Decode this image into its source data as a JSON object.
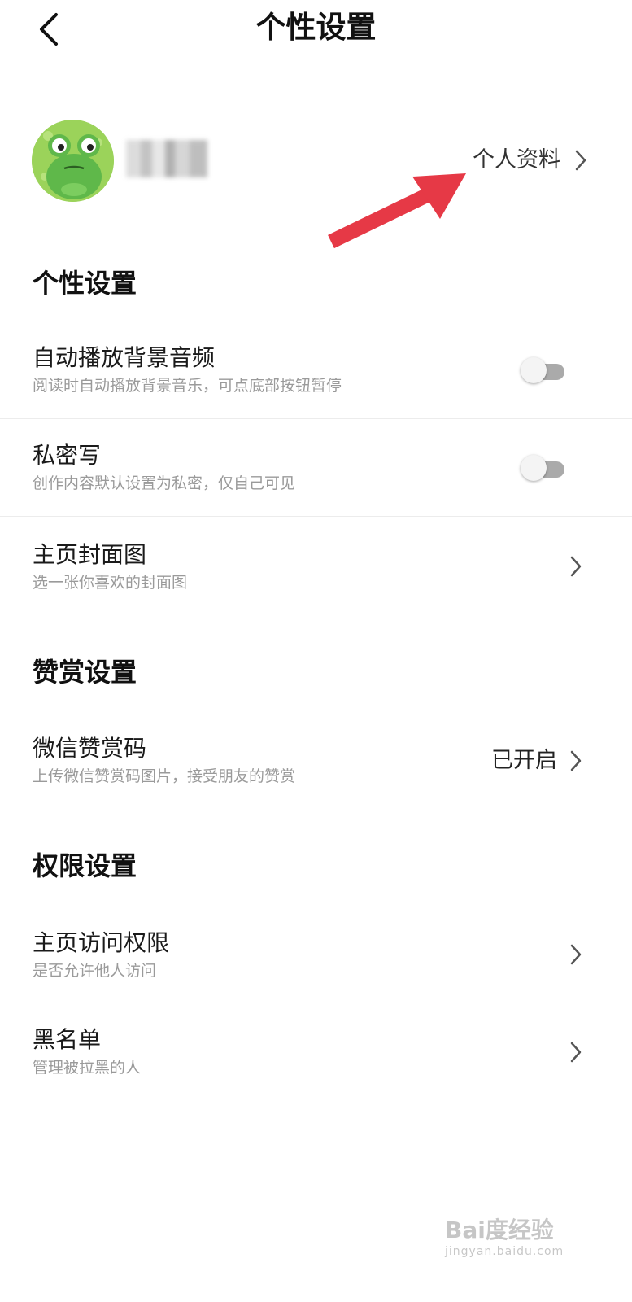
{
  "header": {
    "title": "个性设置",
    "back_icon": "chevron-left-icon"
  },
  "profile": {
    "avatar_icon": "frog-avatar",
    "username_blurred": true,
    "link_label": "个人资料"
  },
  "sections": {
    "personal": {
      "title": "个性设置",
      "items": [
        {
          "title": "自动播放背景音频",
          "subtitle": "阅读时自动播放背景音乐，可点底部按钮暂停",
          "control": "toggle",
          "enabled": false
        },
        {
          "title": "私密写",
          "subtitle": "创作内容默认设置为私密，仅自己可见",
          "control": "toggle",
          "enabled": false
        },
        {
          "title": "主页封面图",
          "subtitle": "选一张你喜欢的封面图",
          "control": "chevron"
        }
      ]
    },
    "reward": {
      "title": "赞赏设置",
      "items": [
        {
          "title": "微信赞赏码",
          "subtitle": "上传微信赞赏码图片，接受朋友的赞赏",
          "value": "已开启",
          "control": "chevron"
        }
      ]
    },
    "permission": {
      "title": "权限设置",
      "items": [
        {
          "title": "主页访问权限",
          "subtitle": "是否允许他人访问",
          "control": "chevron"
        },
        {
          "title": "黑名单",
          "subtitle": "管理被拉黑的人",
          "control": "chevron"
        }
      ]
    }
  },
  "colors": {
    "annotation_arrow": "#e63946",
    "toggle_off_track": "#aaaaaa",
    "avatar_green": "#6cc24a"
  },
  "watermark": {
    "line1": "Bai度经验",
    "line2": "jingyan.baidu.com"
  }
}
